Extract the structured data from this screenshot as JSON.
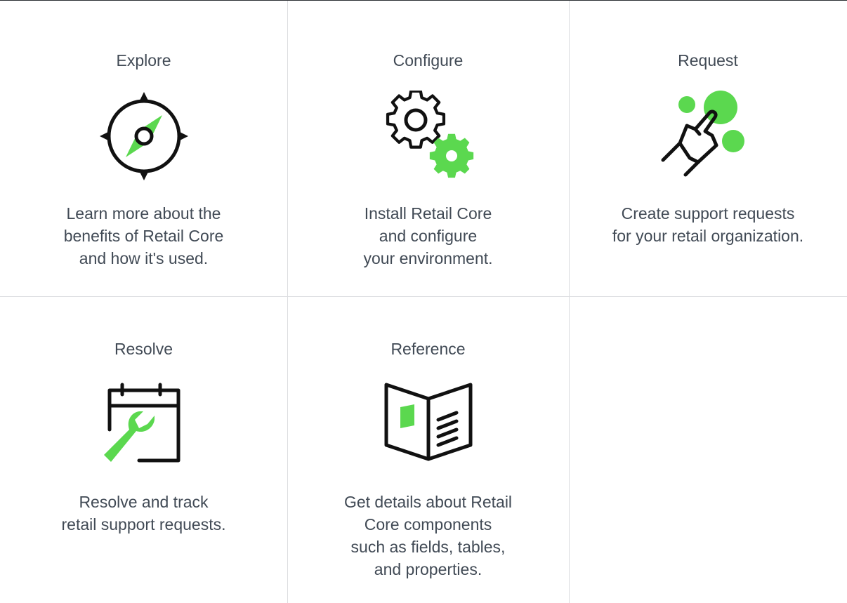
{
  "colors": {
    "accent": "#5bd84f",
    "text": "#414a55",
    "icon_stroke": "#111111",
    "divider": "#dcdde0"
  },
  "cards": [
    {
      "title": "Explore",
      "icon": "compass-icon",
      "desc": [
        "Learn more about the",
        "benefits of Retail Core",
        "and how it's used."
      ]
    },
    {
      "title": "Configure",
      "icon": "gears-icon",
      "desc": [
        "Install Retail Core",
        "and configure",
        "your environment."
      ]
    },
    {
      "title": "Request",
      "icon": "pointing-hand-icon",
      "desc": [
        "Create support requests",
        "for your retail organization."
      ]
    },
    {
      "title": "Resolve",
      "icon": "calendar-wrench-icon",
      "desc": [
        "Resolve and track",
        "retail support requests."
      ]
    },
    {
      "title": "Reference",
      "icon": "open-book-icon",
      "desc": [
        "Get details about Retail",
        "Core components",
        "such as fields, tables,",
        "and properties."
      ]
    }
  ]
}
